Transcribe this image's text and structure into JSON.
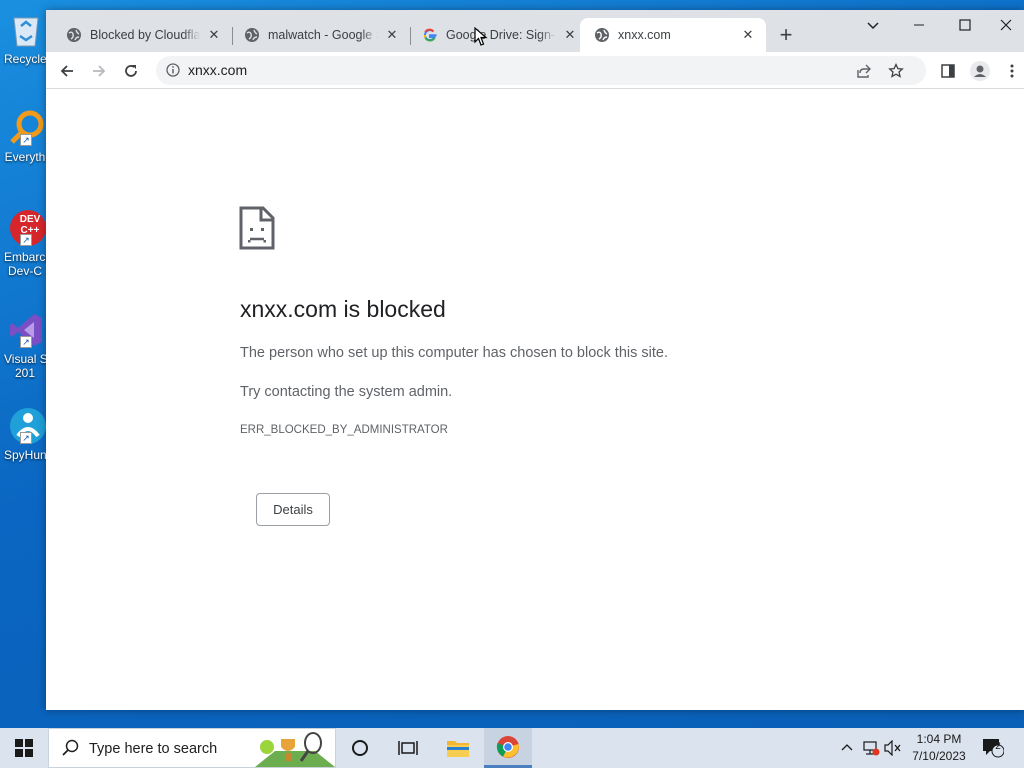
{
  "desktop": {
    "icons": [
      {
        "label": "Recycle",
        "icon": "recycle-bin-icon"
      },
      {
        "label": "Everyth",
        "icon": "everything-search-icon"
      },
      {
        "label": "Embarca",
        "label2": "Dev-C",
        "icon": "devcpp-icon",
        "badge": "DEV C++"
      },
      {
        "label": "Visual S",
        "label2": "201",
        "icon": "visual-studio-icon"
      },
      {
        "label": "SpyHun",
        "icon": "spyhunter-icon"
      }
    ]
  },
  "browser": {
    "tabs": [
      {
        "title": "Blocked by Cloudflare",
        "favicon": "globe-icon",
        "active": false
      },
      {
        "title": "malwatch - Google Search",
        "favicon": "globe-icon",
        "active": false
      },
      {
        "title": "Google Drive: Sign-in",
        "favicon": "google-icon",
        "active": false
      },
      {
        "title": "xnxx.com",
        "favicon": "globe-icon",
        "active": true
      }
    ],
    "new_tab_label": "+",
    "address": "xnxx.com"
  },
  "error_page": {
    "title": "xnxx.com is blocked",
    "message": "The person who set up this computer has chosen to block this site.",
    "suggestion": "Try contacting the system admin.",
    "code": "ERR_BLOCKED_BY_ADMINISTRATOR",
    "details_label": "Details"
  },
  "taskbar": {
    "search_placeholder": "Type here to search",
    "time": "1:04 PM",
    "date": "7/10/2023",
    "notification_count": "2"
  },
  "colors": {
    "desktop_blue": "#0a66c2",
    "tabstrip": "#dee1e6",
    "taskbar": "#dbe4ee"
  }
}
